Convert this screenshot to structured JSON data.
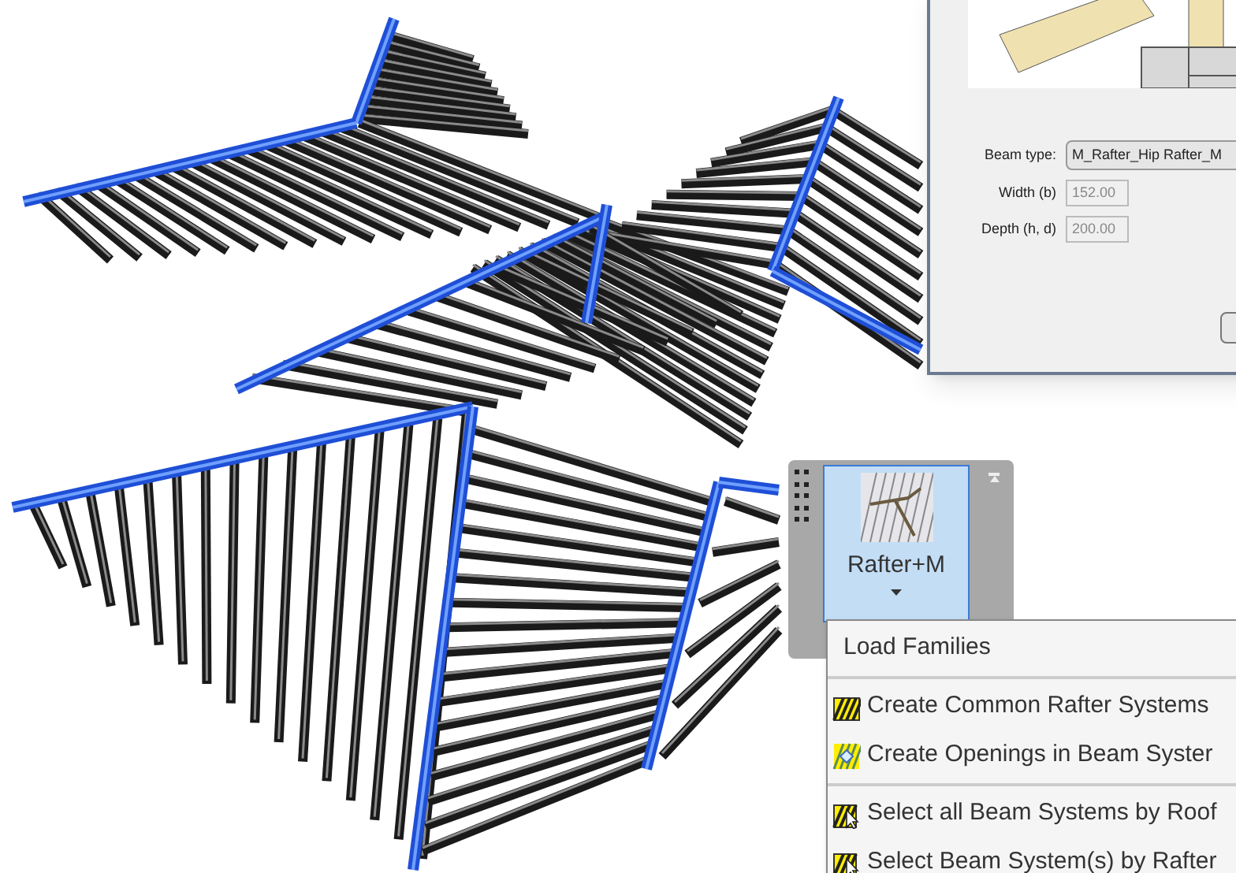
{
  "dialog": {
    "fields": [
      {
        "label": "Beam type:",
        "value": "M_Rafter_Hip Rafter_M",
        "kind": "select",
        "disabled": false
      },
      {
        "label": "Width (b)",
        "value": "152.00",
        "kind": "input",
        "disabled": true
      },
      {
        "label": "Depth (h, d)",
        "value": "200.00",
        "kind": "input",
        "disabled": true
      }
    ]
  },
  "ribbon": {
    "button": {
      "label": "Rafter+M",
      "selected": true
    }
  },
  "menu": {
    "groups": [
      [
        {
          "label": "Load Families",
          "kind": "plain"
        }
      ],
      [
        {
          "label": "Create Common Rafter Systems",
          "kind": "rafter"
        },
        {
          "label": "Create Openings in Beam Syster",
          "kind": "opening"
        }
      ],
      [
        {
          "label": "Select all Beam Systems by Roof",
          "kind": "select"
        },
        {
          "label": "Select Beam System(s) by Rafter",
          "kind": "select"
        }
      ]
    ]
  }
}
